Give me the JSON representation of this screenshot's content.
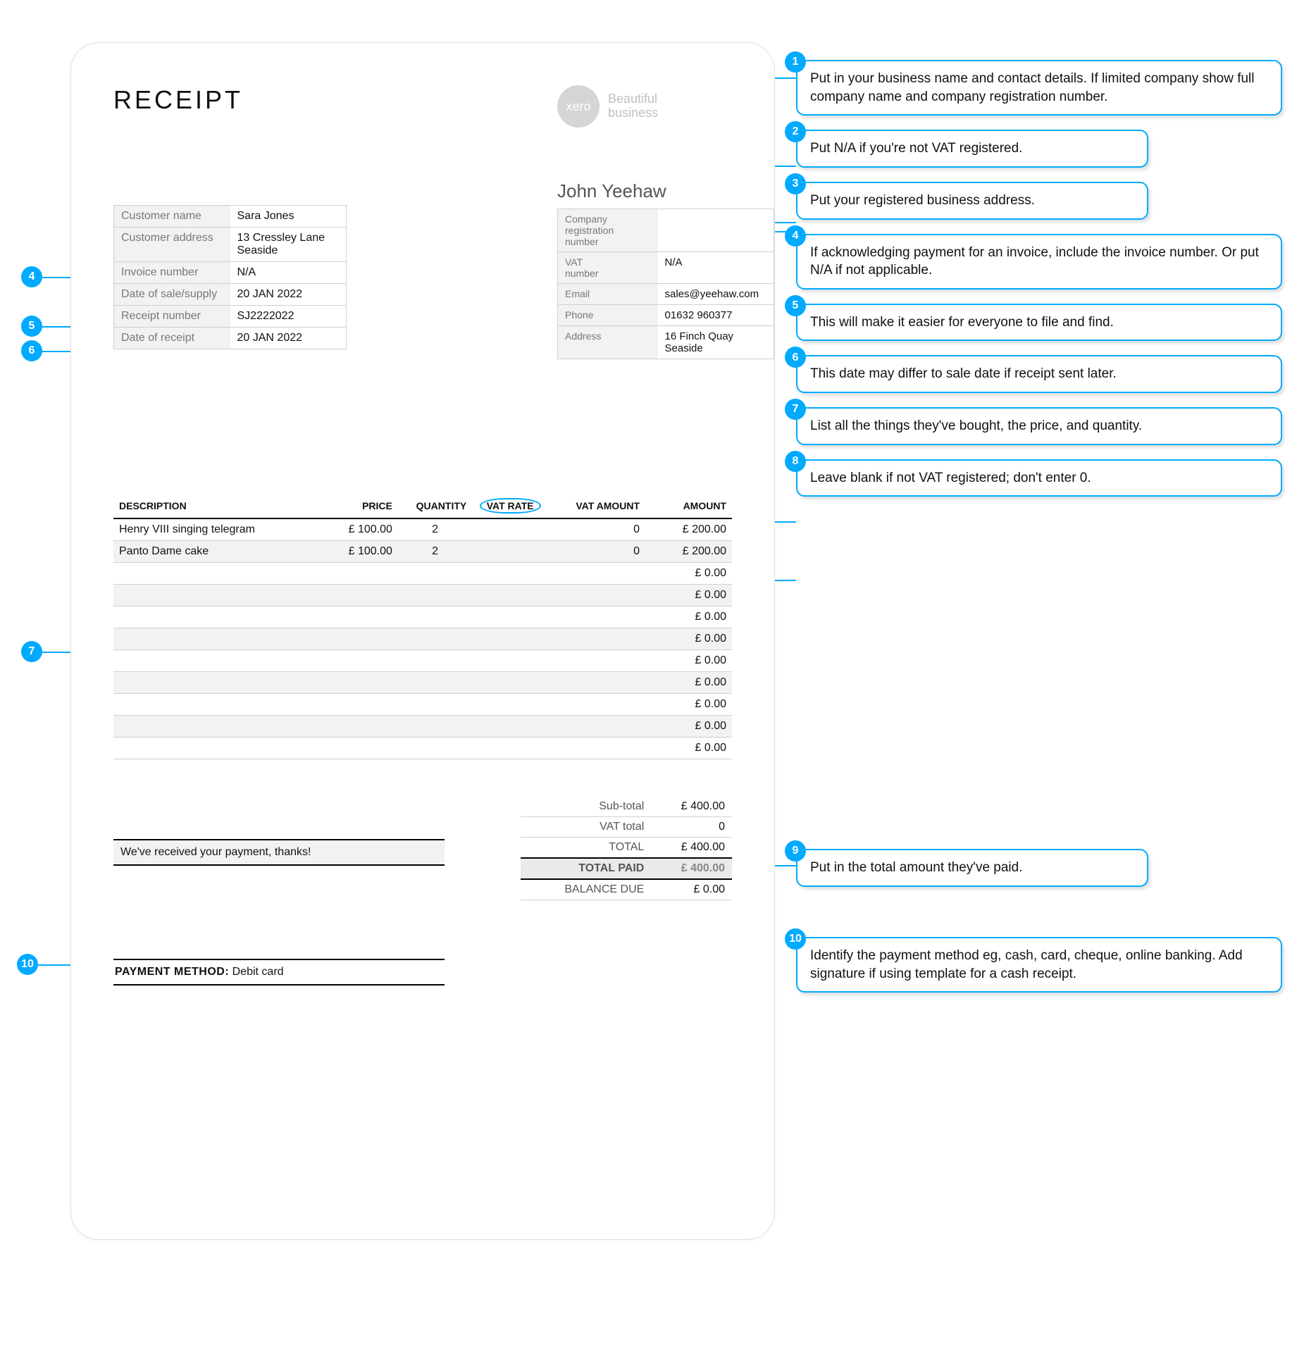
{
  "title": "RECEIPT",
  "logo": {
    "word": "xero",
    "tag1": "Beautiful",
    "tag2": "business"
  },
  "business_name": "John Yeehaw",
  "customer": {
    "rows": [
      {
        "k": "Customer name",
        "v": "Sara Jones"
      },
      {
        "k": "Customer address",
        "v": "13 Cressley Lane\nSeaside"
      },
      {
        "k": "Invoice number",
        "v": "N/A"
      },
      {
        "k": "Date of sale/supply",
        "v": "20 JAN 2022"
      },
      {
        "k": "Receipt number",
        "v": "SJ2222022"
      },
      {
        "k": "Date of receipt",
        "v": "20 JAN 2022"
      }
    ]
  },
  "business": {
    "rows": [
      {
        "k": "Company\nregistration\nnumber",
        "v": ""
      },
      {
        "k": "VAT\nnumber",
        "v": "N/A"
      },
      {
        "k": "Email",
        "v": "sales@yeehaw.com"
      },
      {
        "k": "Phone",
        "v": "01632 960377"
      },
      {
        "k": "Address",
        "v": "16 Finch Quay\nSeaside"
      }
    ]
  },
  "headers": {
    "desc": "DESCRIPTION",
    "price": "PRICE",
    "qty": "QUANTITY",
    "vrate": "VAT RATE",
    "vamt": "VAT AMOUNT",
    "amt": "AMOUNT"
  },
  "items": [
    {
      "desc": "Henry VIII singing telegram",
      "price": "£ 100.00",
      "qty": "2",
      "vrate": "",
      "vamt": "0",
      "amt": "£ 200.00"
    },
    {
      "desc": "Panto Dame cake",
      "price": "£ 100.00",
      "qty": "2",
      "vrate": "",
      "vamt": "0",
      "amt": "£ 200.00"
    },
    {
      "desc": "",
      "price": "",
      "qty": "",
      "vrate": "",
      "vamt": "",
      "amt": "£ 0.00"
    },
    {
      "desc": "",
      "price": "",
      "qty": "",
      "vrate": "",
      "vamt": "",
      "amt": "£ 0.00"
    },
    {
      "desc": "",
      "price": "",
      "qty": "",
      "vrate": "",
      "vamt": "",
      "amt": "£ 0.00"
    },
    {
      "desc": "",
      "price": "",
      "qty": "",
      "vrate": "",
      "vamt": "",
      "amt": "£ 0.00"
    },
    {
      "desc": "",
      "price": "",
      "qty": "",
      "vrate": "",
      "vamt": "",
      "amt": "£ 0.00"
    },
    {
      "desc": "",
      "price": "",
      "qty": "",
      "vrate": "",
      "vamt": "",
      "amt": "£ 0.00"
    },
    {
      "desc": "",
      "price": "",
      "qty": "",
      "vrate": "",
      "vamt": "",
      "amt": "£ 0.00"
    },
    {
      "desc": "",
      "price": "",
      "qty": "",
      "vrate": "",
      "vamt": "",
      "amt": "£ 0.00"
    },
    {
      "desc": "",
      "price": "",
      "qty": "",
      "vrate": "",
      "vamt": "",
      "amt": "£ 0.00"
    }
  ],
  "totals": {
    "sub_k": "Sub-total",
    "sub_v": "£ 400.00",
    "vat_k": "VAT total",
    "vat_v": "0",
    "tot_k": "TOTAL",
    "tot_v": "£ 400.00",
    "paid_k": "TOTAL PAID",
    "paid_v": "£ 400.00",
    "bal_k": "BALANCE DUE",
    "bal_v": "£ 0.00"
  },
  "note": "We've received your payment, thanks!",
  "payment": {
    "label": "PAYMENT METHOD:",
    "value": "Debit card"
  },
  "callouts": [
    {
      "n": "1",
      "t": "Put in your business name and contact details. If limited company show full company name and company registration number."
    },
    {
      "n": "2",
      "t": "Put N/A if you're not VAT registered."
    },
    {
      "n": "3",
      "t": "Put your registered business address."
    },
    {
      "n": "4",
      "t": "If acknowledging payment for an invoice, include the invoice number. Or put N/A if not applicable."
    },
    {
      "n": "5",
      "t": "This will make it easier for everyone to file and find."
    },
    {
      "n": "6",
      "t": "This date may differ to sale date if receipt sent later."
    },
    {
      "n": "7",
      "t": "List all the things they've bought, the price, and quantity."
    },
    {
      "n": "8",
      "t": "Leave blank if not VAT registered; don't enter 0."
    },
    {
      "n": "9",
      "t": "Put in the total amount they've paid."
    },
    {
      "n": "10",
      "t": "Identify the payment method eg, cash, card, cheque, online banking. Add signature if using template for a cash receipt."
    }
  ],
  "leftbadges": {
    "b4": "4",
    "b5": "5",
    "b6": "6",
    "b7": "7",
    "b10": "10"
  }
}
